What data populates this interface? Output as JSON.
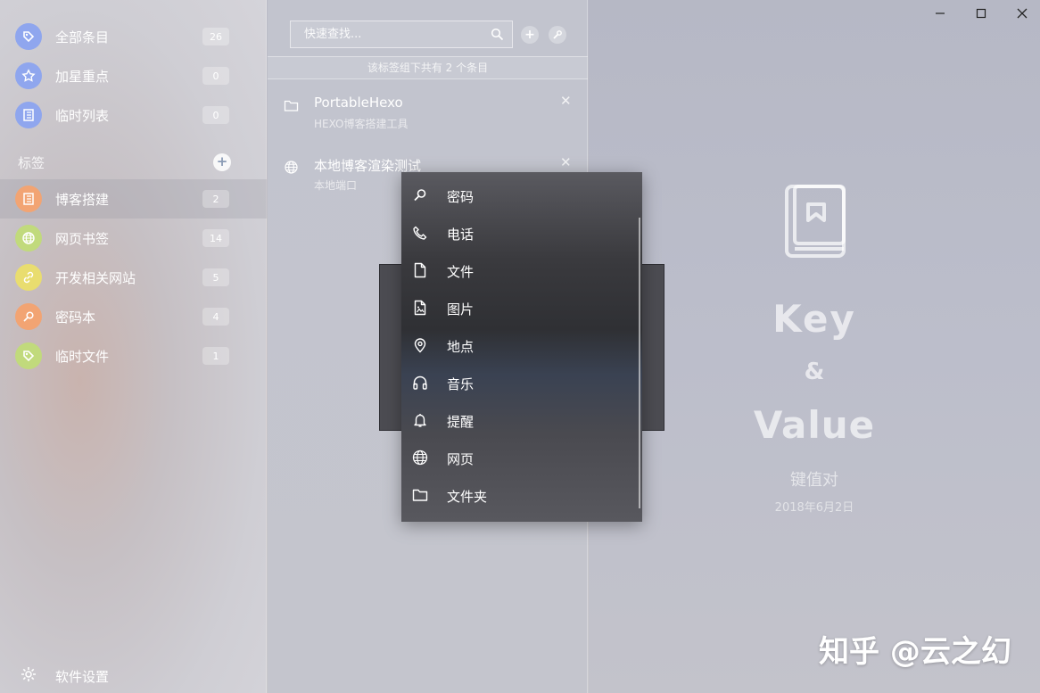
{
  "sidebar": {
    "top_items": [
      {
        "label": "全部条目",
        "count": "26",
        "icon": "tag-icon",
        "color": "#8fa6ee"
      },
      {
        "label": "加星重点",
        "count": "0",
        "icon": "star-icon",
        "color": "#8fa6ee"
      },
      {
        "label": "临时列表",
        "count": "0",
        "icon": "list-icon",
        "color": "#8fa6ee"
      }
    ],
    "section_title": "标签",
    "add_symbol": "+",
    "tags": [
      {
        "label": "博客搭建",
        "count": "2",
        "icon": "list-icon",
        "color": "#f2a473",
        "active": true
      },
      {
        "label": "网页书签",
        "count": "14",
        "icon": "globe-icon",
        "color": "#c1da7c"
      },
      {
        "label": "开发相关网站",
        "count": "5",
        "icon": "link-icon",
        "color": "#e9dd6f"
      },
      {
        "label": "密码本",
        "count": "4",
        "icon": "key-icon",
        "color": "#f2a473"
      },
      {
        "label": "临时文件",
        "count": "1",
        "icon": "tag-icon",
        "color": "#c1da7c"
      }
    ],
    "settings_label": "软件设置"
  },
  "list": {
    "search_placeholder": "快速查找...",
    "add_symbol": "+",
    "count_text": "该标签组下共有 2 个条目",
    "entries": [
      {
        "title": "PortableHexo",
        "subtitle": "HEXO博客搭建工具",
        "icon": "folder-icon",
        "close": "✕"
      },
      {
        "title": "本地博客渲染测试",
        "subtitle": "本地端口",
        "icon": "globe-icon",
        "close": "✕"
      }
    ]
  },
  "menu": {
    "items": [
      {
        "label": "密码",
        "icon": "key-icon"
      },
      {
        "label": "电话",
        "icon": "phone-icon"
      },
      {
        "label": "文件",
        "icon": "file-icon"
      },
      {
        "label": "图片",
        "icon": "image-icon"
      },
      {
        "label": "地点",
        "icon": "location-icon"
      },
      {
        "label": "音乐",
        "icon": "headphones-icon"
      },
      {
        "label": "提醒",
        "icon": "bell-icon"
      },
      {
        "label": "网页",
        "icon": "globe-icon"
      },
      {
        "label": "文件夹",
        "icon": "folder-icon"
      }
    ]
  },
  "detail": {
    "logo_key": "Key",
    "logo_amp": "&",
    "logo_value": "Value",
    "subtitle": "键值对",
    "date": "2018年6月2日",
    "watermark": "知乎 @云之幻"
  }
}
